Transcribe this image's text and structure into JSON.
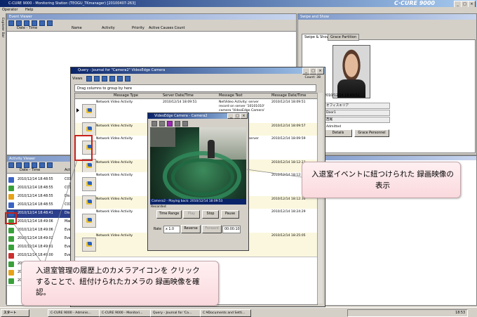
{
  "app": {
    "title": "C-CURE 9000 - Monitoring Station (TEOGU_TKmanager) [20100407-263]",
    "logo": "C·CURE 9000"
  },
  "menu": [
    "Operator",
    "Help"
  ],
  "sidestrip_label": "Explorer Bar",
  "event_viewer": {
    "header": "Event Viewer",
    "columns": [
      "Date - Time",
      "Name",
      "Activity",
      "Priority",
      "Active Causes Count"
    ]
  },
  "activity_viewer": {
    "header": "Activity Viewer",
    "columns": [
      "Date - Time",
      "Act"
    ],
    "rows": [
      {
        "time": "2010/12/14 18:48:55",
        "act": "C01",
        "color": "#3b63c4"
      },
      {
        "time": "2010/12/14 18:48:55",
        "act": "C01",
        "color": "#3aa03a"
      },
      {
        "time": "2010/12/14 18:48:55",
        "act": "Dis",
        "color": "#e6a21a"
      },
      {
        "time": "2010/12/14 18:48:55",
        "act": "C01",
        "color": "#3b63c4"
      },
      {
        "time": "2010/12/14 18:48:41",
        "act": "Dis",
        "color": "#2b5fb5"
      },
      {
        "time": "2010/12/14 18:49:06",
        "act": "Man",
        "color": "#3aa03a"
      },
      {
        "time": "2010/12/14 18:49:06",
        "act": "Ever",
        "color": "#3aa03a"
      },
      {
        "time": "2010/12/14 18:49:02",
        "act": "Ever",
        "color": "#3aa03a"
      },
      {
        "time": "2010/12/14 18:49:01",
        "act": "Ever",
        "color": "#3aa03a"
      },
      {
        "time": "2010/12/14 18:49:00",
        "act": "Ever",
        "color": "#cc3030"
      },
      {
        "time": "2010/12/14 18:49:00",
        "act": "",
        "color": "#3aa03a"
      },
      {
        "time": "2010/12/14 18:49:00",
        "act": "",
        "color": "#e6a21a"
      },
      {
        "time": "2010/12/14 18:48:52",
        "act": "",
        "color": "#3aa03a"
      }
    ],
    "extra_line": "Rejected (Passback) : 西尾, at \"Door1\" 西尾 entering area オフィスエリア",
    "count": "Count: 15"
  },
  "swipe_show": {
    "header": "Swipe and Show",
    "tabs": [
      "Swipe & Show",
      "Grace Partition"
    ],
    "timestamp": "2010/12/14 18:49:52",
    "fields": [
      "オフィスエリア",
      "Door1",
      "西尾",
      "Admitted"
    ],
    "buttons": [
      "Details",
      "Grace Personnel"
    ]
  },
  "query": {
    "title": "Query - Journal for \"Camera2\" VideoEdge Camera",
    "views_label": "Views",
    "count": "Count: 38",
    "group_hint": "Drag columns to group by here",
    "columns": [
      "Message Type",
      "Server Date/Time",
      "Message Text",
      "Message Date/Time"
    ],
    "rows": [
      {
        "type": "Network Video Activity",
        "server": "2010/12/14 18:09:51",
        "text": "NetVideo Activity: server record on server '10101010' camera 'VideoEdge Camera'",
        "msg": "2010/12/14 18:09:51"
      },
      {
        "type": "Network Video Activity",
        "server": "2010/12/14 18:09:57",
        "text": "",
        "msg": "2010/12/14 18:09:57"
      },
      {
        "type": "Network Video Activity",
        "server": "2010/12/14 18:09:59",
        "text": "NetVideo Activity: server record on server",
        "msg": "2010/12/14 18:09:59"
      },
      {
        "type": "Network Video Activity",
        "server": "2010/12/14 18:12:23",
        "text": "",
        "msg": "2010/12/14 18:12:23"
      },
      {
        "type": "Network Video Activity",
        "server": "2010/12/14 18:12:26",
        "text": "",
        "msg": "2010/12/14 18:12:26"
      },
      {
        "type": "Network Video Activity",
        "server": "2010/12/14 18:12:30",
        "text": "",
        "msg": "2010/12/14 18:12:30"
      },
      {
        "type": "Network Video Activity",
        "server": "2010/12/14 18:24:29",
        "text": "",
        "msg": "2010/12/14 18:24:29"
      },
      {
        "type": "Network Video Activity",
        "server": "2010/12/14 18:25:05",
        "text": "",
        "msg": "2010/12/14 18:25:05"
      }
    ]
  },
  "video": {
    "title": "VideoEdge Camera - Camera2",
    "status": "Camera2 - Playing back: 2010/12/14 18:09:53",
    "recorded_label": "Recorded",
    "buttons": {
      "time_range": "Time Range",
      "play": "Play",
      "stop": "Stop",
      "pause": "Pause",
      "reverse": "Reverse",
      "forward": "Forward"
    },
    "rate_label": "Rate",
    "rate_value": "x 1.0",
    "timecode": "00:00:10"
  },
  "callouts": {
    "right": "入退室イベントに紐つけられた 録画映像の表示",
    "left": "入退室管理の履歴上のカメラアイコンを クリックすることで、紐付けられたカメラの 録画映像を確認。"
  },
  "taskbar": {
    "start": "スタート",
    "tasks": [
      "C-CURE 9000 - Adminis...",
      "C-CURE 9000 - Monitori...",
      "Query - Journal for 'Ca...",
      "C:¥Documents and Setti..."
    ],
    "clock": "18:53"
  },
  "colors": {
    "titlebar": "#0a246a",
    "highlight": "#c8201a",
    "callout_bg": "#fad9dd",
    "selected_row": "#2b3f8c"
  }
}
